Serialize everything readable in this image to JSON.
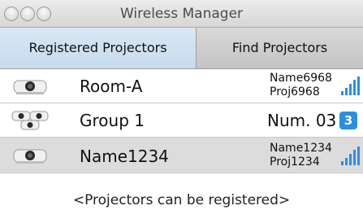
{
  "window": {
    "title": "Wireless Manager"
  },
  "tabs": [
    {
      "label": "Registered Projectors",
      "selected": true
    },
    {
      "label": "Find Projectors",
      "selected": false
    }
  ],
  "projectors": [
    {
      "name": "Room-A",
      "detail_line1": "Name6968",
      "detail_line2": "Proj6968",
      "icon": "projector-icon",
      "indicator": "signal-strength-icon"
    },
    {
      "name": "Group 1",
      "number": "Num. 03",
      "badge": "3",
      "icon": "projector-group-icon",
      "indicator": "count-badge"
    },
    {
      "name": "Name1234",
      "detail_line1": "Name1234",
      "detail_line2": "Proj1234",
      "icon": "projector-icon",
      "indicator": "signal-strength-icon",
      "selected": true
    }
  ],
  "footer": {
    "message": "<Projectors can be registered>"
  },
  "colors": {
    "selected_tab": "#c7dbee",
    "selected_row": "#dcdcdc",
    "badge": "#2b8ee3",
    "signal": "#2e8fe0"
  }
}
